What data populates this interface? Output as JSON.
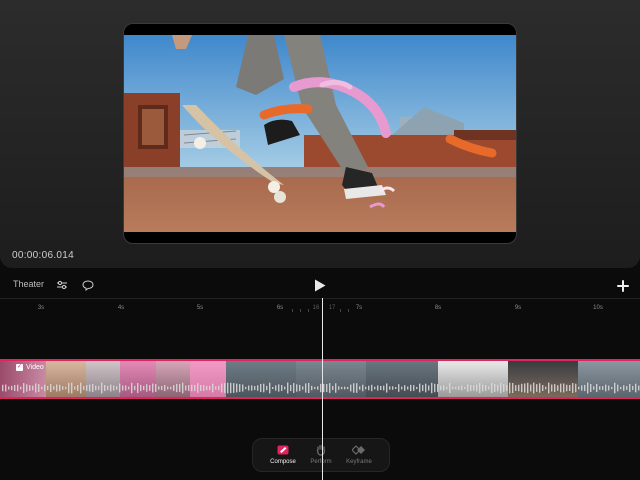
{
  "timecode": "00:00:06.014",
  "toolbar": {
    "theater_label": "Theater",
    "adjust_icon": "sliders-icon",
    "comment_icon": "speech-bubble-icon",
    "play_icon": "play-icon",
    "add_icon": "plus-icon"
  },
  "ruler": {
    "ticks": [
      "3s",
      "4s",
      "5s",
      "6s",
      "7s",
      "8s",
      "9s",
      "10s"
    ],
    "current_frame_labels": [
      "16",
      "17"
    ]
  },
  "track": {
    "label": "Video",
    "checked": true,
    "accent_color": "#e0245e"
  },
  "modes": [
    {
      "label": "Compose",
      "icon": "compose-icon",
      "active": true
    },
    {
      "label": "Perform",
      "icon": "hand-icon",
      "active": false
    },
    {
      "label": "Keyframe",
      "icon": "keyframe-icon",
      "active": false
    }
  ],
  "colors": {
    "accent": "#e0245e",
    "background": "#0b0b0b"
  }
}
